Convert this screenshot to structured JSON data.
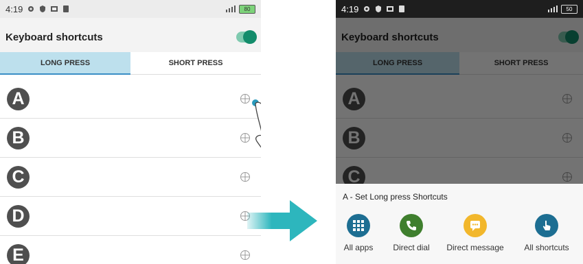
{
  "status": {
    "time": "4:19",
    "battery_left": "80",
    "battery_right": "50"
  },
  "screen": {
    "title": "Keyboard shortcuts",
    "toggle_on": true,
    "tabs": [
      {
        "label": "LONG PRESS"
      },
      {
        "label": "SHORT PRESS"
      }
    ]
  },
  "rows_left": [
    {
      "letter": "A"
    },
    {
      "letter": "B"
    },
    {
      "letter": "C"
    },
    {
      "letter": "D"
    },
    {
      "letter": "E"
    }
  ],
  "rows_right": [
    {
      "letter": "A"
    },
    {
      "letter": "B"
    },
    {
      "letter": "C"
    }
  ],
  "sheet": {
    "title": "A - Set Long press Shortcuts",
    "options": [
      {
        "label": "All apps",
        "icon": "grid-icon",
        "color": "#1d6e92"
      },
      {
        "label": "Direct dial",
        "icon": "phone-icon",
        "color": "#3f7f2e"
      },
      {
        "label": "Direct message",
        "icon": "message-icon",
        "color": "#f2b72c"
      },
      {
        "label": "All shortcuts",
        "icon": "pointer-hand-icon",
        "color": "#1d6e92"
      }
    ]
  },
  "colors": {
    "accent": "#138c6b",
    "tab_active_bg": "#bde0ed",
    "arrow": "#2db6bd"
  }
}
